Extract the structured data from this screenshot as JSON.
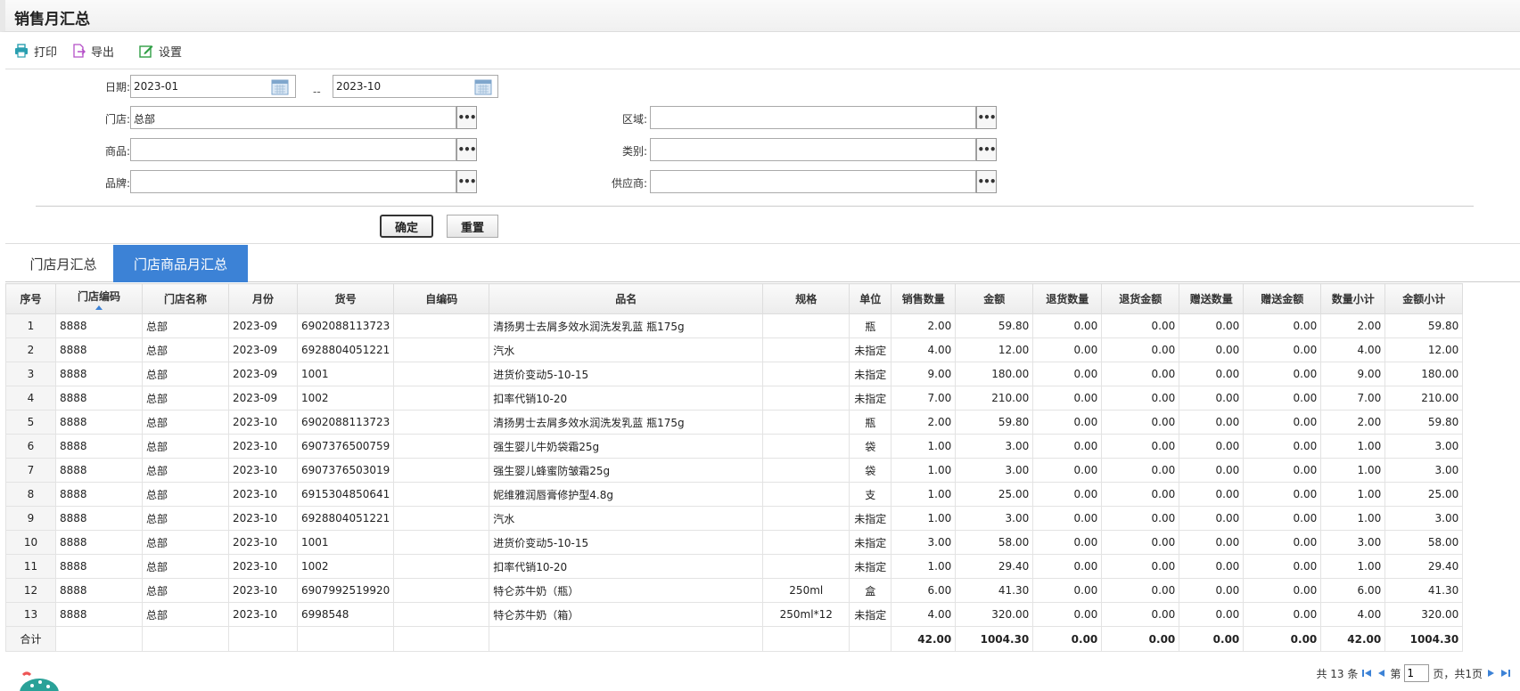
{
  "window": {
    "title": "销售月汇总"
  },
  "toolbar": {
    "print": "打印",
    "export": "导出",
    "settings": "设置"
  },
  "form": {
    "date_label": "日期:",
    "date_from": "2023-01",
    "date_sep": "--",
    "date_to": "2023-10",
    "store_label": "门店:",
    "store_value": "总部",
    "region_label": "区域:",
    "region_value": "",
    "product_label": "商品:",
    "product_value": "",
    "category_label": "类别:",
    "category_value": "",
    "brand_label": "品牌:",
    "brand_value": "",
    "supplier_label": "供应商:",
    "supplier_value": "",
    "picker_glyph": "•••",
    "confirm": "确定",
    "reset": "重置"
  },
  "tabs": [
    {
      "label": "门店月汇总",
      "active": false
    },
    {
      "label": "门店商品月汇总",
      "active": true
    }
  ],
  "table": {
    "columns": [
      "序号",
      "门店编码",
      "门店名称",
      "月份",
      "货号",
      "自编码",
      "品名",
      "规格",
      "单位",
      "销售数量",
      "金额",
      "退货数量",
      "退货金额",
      "赠送数量",
      "赠送金额",
      "数量小计",
      "金额小计"
    ],
    "rows": [
      [
        "1",
        "8888",
        "总部",
        "2023-09",
        "6902088113723",
        "",
        "清扬男士去屑多效水润洗发乳蓝 瓶175g",
        "",
        "瓶",
        "2.00",
        "59.80",
        "0.00",
        "0.00",
        "0.00",
        "0.00",
        "2.00",
        "59.80"
      ],
      [
        "2",
        "8888",
        "总部",
        "2023-09",
        "6928804051221",
        "",
        "汽水",
        "",
        "未指定",
        "4.00",
        "12.00",
        "0.00",
        "0.00",
        "0.00",
        "0.00",
        "4.00",
        "12.00"
      ],
      [
        "3",
        "8888",
        "总部",
        "2023-09",
        "1001",
        "",
        "进货价变动5-10-15",
        "",
        "未指定",
        "9.00",
        "180.00",
        "0.00",
        "0.00",
        "0.00",
        "0.00",
        "9.00",
        "180.00"
      ],
      [
        "4",
        "8888",
        "总部",
        "2023-09",
        "1002",
        "",
        "扣率代销10-20",
        "",
        "未指定",
        "7.00",
        "210.00",
        "0.00",
        "0.00",
        "0.00",
        "0.00",
        "7.00",
        "210.00"
      ],
      [
        "5",
        "8888",
        "总部",
        "2023-10",
        "6902088113723",
        "",
        "清扬男士去屑多效水润洗发乳蓝 瓶175g",
        "",
        "瓶",
        "2.00",
        "59.80",
        "0.00",
        "0.00",
        "0.00",
        "0.00",
        "2.00",
        "59.80"
      ],
      [
        "6",
        "8888",
        "总部",
        "2023-10",
        "6907376500759",
        "",
        "强生婴儿牛奶袋霜25g",
        "",
        "袋",
        "1.00",
        "3.00",
        "0.00",
        "0.00",
        "0.00",
        "0.00",
        "1.00",
        "3.00"
      ],
      [
        "7",
        "8888",
        "总部",
        "2023-10",
        "6907376503019",
        "",
        "强生婴儿蜂蜜防皱霜25g",
        "",
        "袋",
        "1.00",
        "3.00",
        "0.00",
        "0.00",
        "0.00",
        "0.00",
        "1.00",
        "3.00"
      ],
      [
        "8",
        "8888",
        "总部",
        "2023-10",
        "6915304850641",
        "",
        "妮维雅润唇膏修护型4.8g",
        "",
        "支",
        "1.00",
        "25.00",
        "0.00",
        "0.00",
        "0.00",
        "0.00",
        "1.00",
        "25.00"
      ],
      [
        "9",
        "8888",
        "总部",
        "2023-10",
        "6928804051221",
        "",
        "汽水",
        "",
        "未指定",
        "1.00",
        "3.00",
        "0.00",
        "0.00",
        "0.00",
        "0.00",
        "1.00",
        "3.00"
      ],
      [
        "10",
        "8888",
        "总部",
        "2023-10",
        "1001",
        "",
        "进货价变动5-10-15",
        "",
        "未指定",
        "3.00",
        "58.00",
        "0.00",
        "0.00",
        "0.00",
        "0.00",
        "3.00",
        "58.00"
      ],
      [
        "11",
        "8888",
        "总部",
        "2023-10",
        "1002",
        "",
        "扣率代销10-20",
        "",
        "未指定",
        "1.00",
        "29.40",
        "0.00",
        "0.00",
        "0.00",
        "0.00",
        "1.00",
        "29.40"
      ],
      [
        "12",
        "8888",
        "总部",
        "2023-10",
        "6907992519920",
        "",
        "特仑苏牛奶（瓶）",
        "250ml",
        "盒",
        "6.00",
        "41.30",
        "0.00",
        "0.00",
        "0.00",
        "0.00",
        "6.00",
        "41.30"
      ],
      [
        "13",
        "8888",
        "总部",
        "2023-10",
        "6998548",
        "",
        "特仑苏牛奶（箱）",
        "250ml*12",
        "未指定",
        "4.00",
        "320.00",
        "0.00",
        "0.00",
        "0.00",
        "0.00",
        "4.00",
        "320.00"
      ]
    ],
    "total": [
      "合计",
      "",
      "",
      "",
      "",
      "",
      "",
      "",
      "",
      "42.00",
      "1004.30",
      "0.00",
      "0.00",
      "0.00",
      "0.00",
      "42.00",
      "1004.30"
    ]
  },
  "pager": {
    "total_text": "共 13 条",
    "page_prefix": "第",
    "page_value": "1",
    "page_suffix": "页，共1页"
  },
  "colors": {
    "accent": "#3c82d6",
    "print_icon": "#2a9fb0",
    "export_icon": "#b550c8",
    "settings_icon": "#2f9e44"
  }
}
